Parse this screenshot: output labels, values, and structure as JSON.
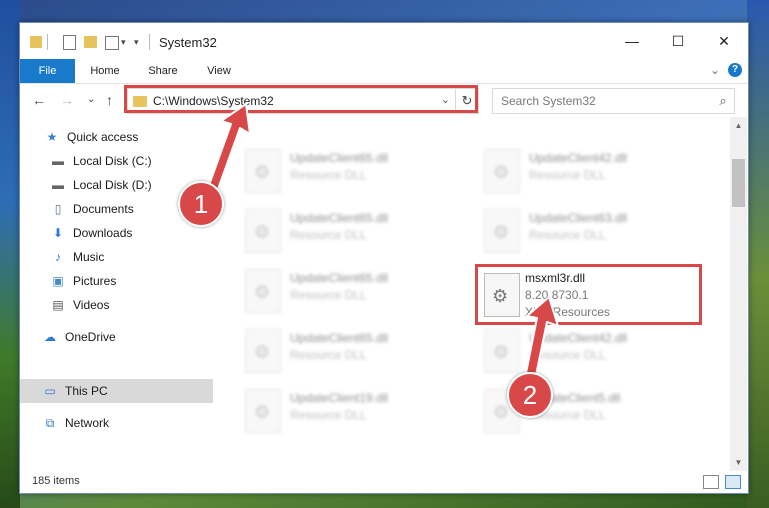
{
  "window": {
    "title": "System32",
    "minimize_glyph": "—",
    "maximize_glyph": "☐",
    "close_glyph": "✕"
  },
  "ribbon": {
    "tabs": [
      "File",
      "Home",
      "Share",
      "View"
    ],
    "expand_glyph": "⌄",
    "help_glyph": "?"
  },
  "nav": {
    "back_glyph": "←",
    "forward_glyph": "→",
    "recent_glyph": "⌄",
    "up_glyph": "↑"
  },
  "address": {
    "path": "C:\\Windows\\System32",
    "dropdown_glyph": "⌄",
    "refresh_glyph": "↻"
  },
  "search": {
    "placeholder": "Search System32",
    "icon_glyph": "⌕"
  },
  "sidebar": {
    "items": [
      {
        "label": "Quick access",
        "icon": "star-icon",
        "glyph": "★",
        "color": "#3a7fd5",
        "pinned": false
      },
      {
        "label": "Local Disk (C:)",
        "icon": "drive-icon",
        "glyph": "▬",
        "color": "#666666",
        "pinned": true
      },
      {
        "label": "Local Disk (D:)",
        "icon": "drive-icon",
        "glyph": "▬",
        "color": "#666666",
        "pinned": true
      },
      {
        "label": "Documents",
        "icon": "document-icon",
        "glyph": "🗎",
        "color": "#5a6e8a",
        "pinned": true
      },
      {
        "label": "Downloads",
        "icon": "download-icon",
        "glyph": "⬇",
        "color": "#2f7ad1",
        "pinned": true
      },
      {
        "label": "Music",
        "icon": "music-icon",
        "glyph": "♪",
        "color": "#2f7ad1",
        "pinned": true
      },
      {
        "label": "Pictures",
        "icon": "pictures-icon",
        "glyph": "▣",
        "color": "#4a8ac8",
        "pinned": true
      },
      {
        "label": "Videos",
        "icon": "video-icon",
        "glyph": "▤",
        "color": "#555555",
        "pinned": true
      },
      {
        "label": "OneDrive",
        "icon": "cloud-icon",
        "glyph": "☁",
        "color": "#2f7ad1",
        "pinned": false
      },
      {
        "label": "This PC",
        "icon": "computer-icon",
        "glyph": "🖥",
        "color": "#2f7ad1",
        "pinned": false,
        "selected": true
      },
      {
        "label": "Network",
        "icon": "network-icon",
        "glyph": "🖧",
        "color": "#2f7ad1",
        "pinned": false
      }
    ],
    "pin_glyph": "📌"
  },
  "files": {
    "blurred": [
      {
        "name": "UpdateClient65.dll",
        "type": "Resource DLL"
      },
      {
        "name": "UpdateClient42.dll",
        "type": "Resource DLL"
      },
      {
        "name": "UpdateClient65.dll",
        "type": "Resource DLL"
      },
      {
        "name": "UpdateClient63.dll",
        "type": "Resource DLL"
      },
      {
        "name": "UpdateClient65.dll",
        "type": "Resource DLL"
      },
      {
        "name": "UpdateClient65.dll",
        "type": "Resource DLL"
      },
      {
        "name": "UpdateClient42.dll",
        "type": "Resource DLL"
      },
      {
        "name": "UpdateClient19.dll",
        "type": "Resource DLL"
      },
      {
        "name": "UpdateClient5.dll",
        "type": "Resource DLL"
      }
    ],
    "focus": {
      "name": "msxml3r.dll",
      "version": "8.20.8730.1",
      "description": "XML Resources"
    }
  },
  "status": {
    "item_count": "185 items"
  },
  "annotations": {
    "marker1": "1",
    "marker2": "2",
    "color": "#d94848"
  }
}
